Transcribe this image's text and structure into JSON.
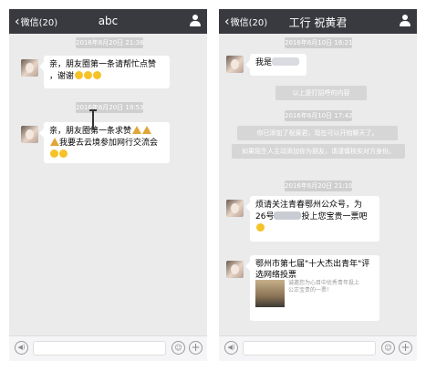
{
  "left": {
    "back_label": "微信(20)",
    "title": "abc",
    "messages": [
      {
        "timestamp": "2016年6月20日 21:36"
      },
      {
        "text_line1": "亲，朋友圈第一条请帮忙点赞",
        "text_line2": "，谢谢"
      },
      {
        "timestamp": "2016年6月20日 19:53"
      },
      {
        "text_line1": "亲，朋友圈第一条求赞",
        "text_line2": "我要去云境参加网行交流会"
      }
    ]
  },
  "right": {
    "back_label": "微信(20)",
    "title": "工行 祝黄君",
    "messages": [
      {
        "timestamp": "2016年6月10日 16:21"
      },
      {
        "text": "我是"
      },
      {
        "system": "以上是打招呼的内容"
      },
      {
        "timestamp": "2016年6月10日 17:42"
      },
      {
        "system": "你已添加了祝黄君，现在可以开始聊天了。"
      },
      {
        "system": "如果陌生人主动添加你为朋友，请谨慎核实对方身份。"
      },
      {
        "timestamp": "2016年6月20日 21:10"
      },
      {
        "text_line1": "烦请关注青春鄂州公众号，为",
        "text_line2_a": "26号",
        "text_line2_b": "投上您宝贵一票吧"
      },
      {
        "link_title_line1": "鄂州市第七届\"十大杰出青年\"评",
        "link_title_line2": "选网络投票",
        "link_desc": "诚邀您为心目中优秀青年投上公正宝贵的一票！"
      }
    ]
  },
  "icons": {
    "voice": "voice-icon",
    "emoji": "emoji-icon",
    "plus": "plus-icon",
    "profile": "profile-icon",
    "back": "chevron-left-icon"
  }
}
